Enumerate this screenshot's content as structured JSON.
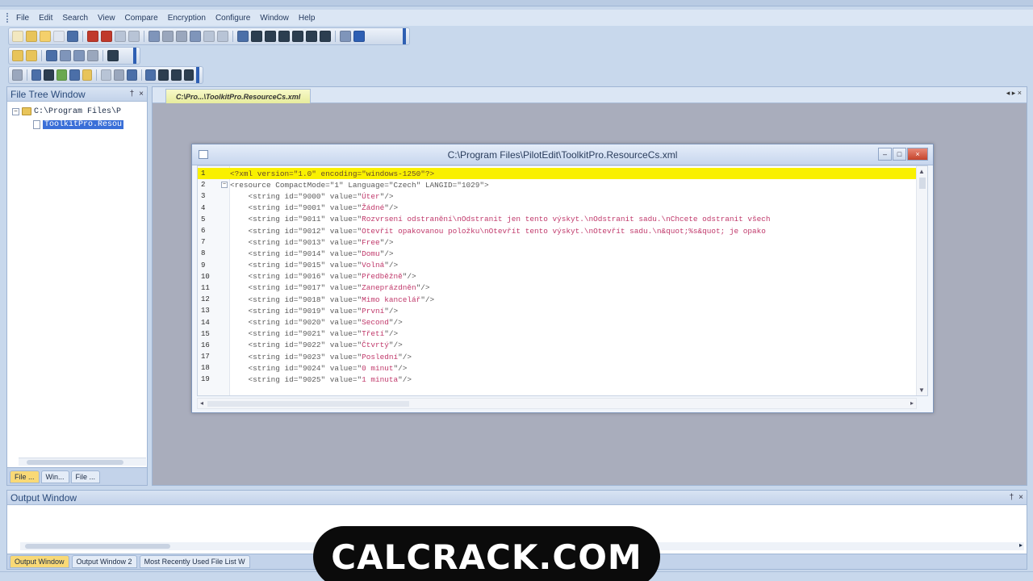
{
  "menu": [
    "File",
    "Edit",
    "Search",
    "View",
    "Compare",
    "Encryption",
    "Configure",
    "Window",
    "Help"
  ],
  "toolbar1_colors": [
    "#f2e8c0",
    "#e8c45a",
    "#f4d06b",
    "#e0e6f0",
    "#4b6fa8",
    "#c0392b",
    "#c0392b",
    "#b8c4d6",
    "#b8c4d6",
    "#7f95ba",
    "#9aa7bd",
    "#9aa7bd",
    "#7f95ba",
    "#b8c4d6",
    "#b8c4d6",
    "#4b6fa8",
    "#2c3e50",
    "#2c3e50",
    "#2c3e50",
    "#2c3e50",
    "#2c3e50",
    "#2c3e50",
    "#7f95ba",
    "#2e5fb3"
  ],
  "toolbar2_colors": [
    "#e8c45a",
    "#e8c45a",
    "#4b6fa8",
    "#7f95ba",
    "#7f95ba",
    "#9aa7bd",
    "#2c3e50"
  ],
  "toolbar3_colors": [
    "#9aa7bd",
    "#4b6fa8",
    "#2c3e50",
    "#6aa84f",
    "#4b6fa8",
    "#e8c45a",
    "#b8c4d6",
    "#9aa7bd",
    "#4b6fa8",
    "#4b6fa8",
    "#2c3e50",
    "#2c3e50",
    "#2c3e50"
  ],
  "file_tree": {
    "title": "File Tree Window",
    "buttons": [
      "†",
      "×"
    ],
    "root": "C:\\Program Files\\P",
    "selected_file": "ToolkitPro.Resou",
    "tabs": [
      "File ...",
      "Win...",
      "File ..."
    ]
  },
  "document": {
    "tab_label": "C:\\Pro...\\ToolkitPro.ResourceCs.xml",
    "nav": "◂ ▸ ×",
    "window_title": "C:\\Program Files\\PilotEdit\\ToolkitPro.ResourceCs.xml",
    "window_buttons": [
      "–",
      "□",
      "×"
    ]
  },
  "code_lines": [
    {
      "n": "1",
      "fold": "",
      "pre": "<?xml version=\"1.0\" encoding=\"windows-1250\"?>",
      "val": "",
      "post": "",
      "hl": true
    },
    {
      "n": "2",
      "fold": "-",
      "pre": "<resource CompactMode=\"1\" Language=\"Czech\" LANGID=\"1029\">",
      "val": "",
      "post": "",
      "hl": false
    },
    {
      "n": "3",
      "fold": "",
      "pre": "    <string id=\"9000\" value=\"",
      "val": "Úter",
      "post": "\"/>",
      "hl": false
    },
    {
      "n": "4",
      "fold": "",
      "pre": "    <string id=\"9001\" value=\"",
      "val": "Žádné",
      "post": "\"/>",
      "hl": false
    },
    {
      "n": "5",
      "fold": "",
      "pre": "    <string id=\"9011\" value=\"",
      "val": "Rozvrsení odstranění\\nOdstranit jen tento výskyt.\\nOdstranit sadu.\\nChcete odstranit všech",
      "post": "",
      "hl": false
    },
    {
      "n": "6",
      "fold": "",
      "pre": "    <string id=\"9012\" value=\"",
      "val": "Otevřít opakovanou položku\\nOtevřít tento výskyt.\\nOtevřít sadu.\\n&quot;%s&quot; je opako",
      "post": "",
      "hl": false
    },
    {
      "n": "7",
      "fold": "",
      "pre": "    <string id=\"9013\" value=\"",
      "val": "Free",
      "post": "\"/>",
      "hl": false
    },
    {
      "n": "8",
      "fold": "",
      "pre": "    <string id=\"9014\" value=\"",
      "val": "Domu",
      "post": "\"/>",
      "hl": false
    },
    {
      "n": "9",
      "fold": "",
      "pre": "    <string id=\"9015\" value=\"",
      "val": "Volná",
      "post": "\"/>",
      "hl": false
    },
    {
      "n": "10",
      "fold": "",
      "pre": "    <string id=\"9016\" value=\"",
      "val": "Předběžně",
      "post": "\"/>",
      "hl": false
    },
    {
      "n": "11",
      "fold": "",
      "pre": "    <string id=\"9017\" value=\"",
      "val": "Zaneprázdněn",
      "post": "\"/>",
      "hl": false
    },
    {
      "n": "12",
      "fold": "",
      "pre": "    <string id=\"9018\" value=\"",
      "val": "Mimo kancelář",
      "post": "\"/>",
      "hl": false
    },
    {
      "n": "13",
      "fold": "",
      "pre": "    <string id=\"9019\" value=\"",
      "val": "První",
      "post": "\"/>",
      "hl": false
    },
    {
      "n": "14",
      "fold": "",
      "pre": "    <string id=\"9020\" value=\"",
      "val": "Second",
      "post": "\"/>",
      "hl": false
    },
    {
      "n": "15",
      "fold": "",
      "pre": "    <string id=\"9021\" value=\"",
      "val": "Třetí",
      "post": "\"/>",
      "hl": false
    },
    {
      "n": "16",
      "fold": "",
      "pre": "    <string id=\"9022\" value=\"",
      "val": "Čtvrtý",
      "post": "\"/>",
      "hl": false
    },
    {
      "n": "17",
      "fold": "",
      "pre": "    <string id=\"9023\" value=\"",
      "val": "Poslední",
      "post": "\"/>",
      "hl": false
    },
    {
      "n": "18",
      "fold": "",
      "pre": "    <string id=\"9024\" value=\"",
      "val": "0 minut",
      "post": "\"/>",
      "hl": false
    },
    {
      "n": "19",
      "fold": "",
      "pre": "    <string id=\"9025\" value=\"",
      "val": "1 minuta",
      "post": "\"/>",
      "hl": false
    }
  ],
  "output": {
    "title": "Output Window",
    "buttons": [
      "†",
      "×"
    ],
    "tabs": [
      "Output Window",
      "Output Window 2",
      "Most Recently Used File List W"
    ]
  },
  "watermark": "CALCRACK.COM",
  "colors": {
    "accent": "#2e5fb3",
    "highlight": "#f9f000",
    "attr_value": "#c0396b"
  }
}
